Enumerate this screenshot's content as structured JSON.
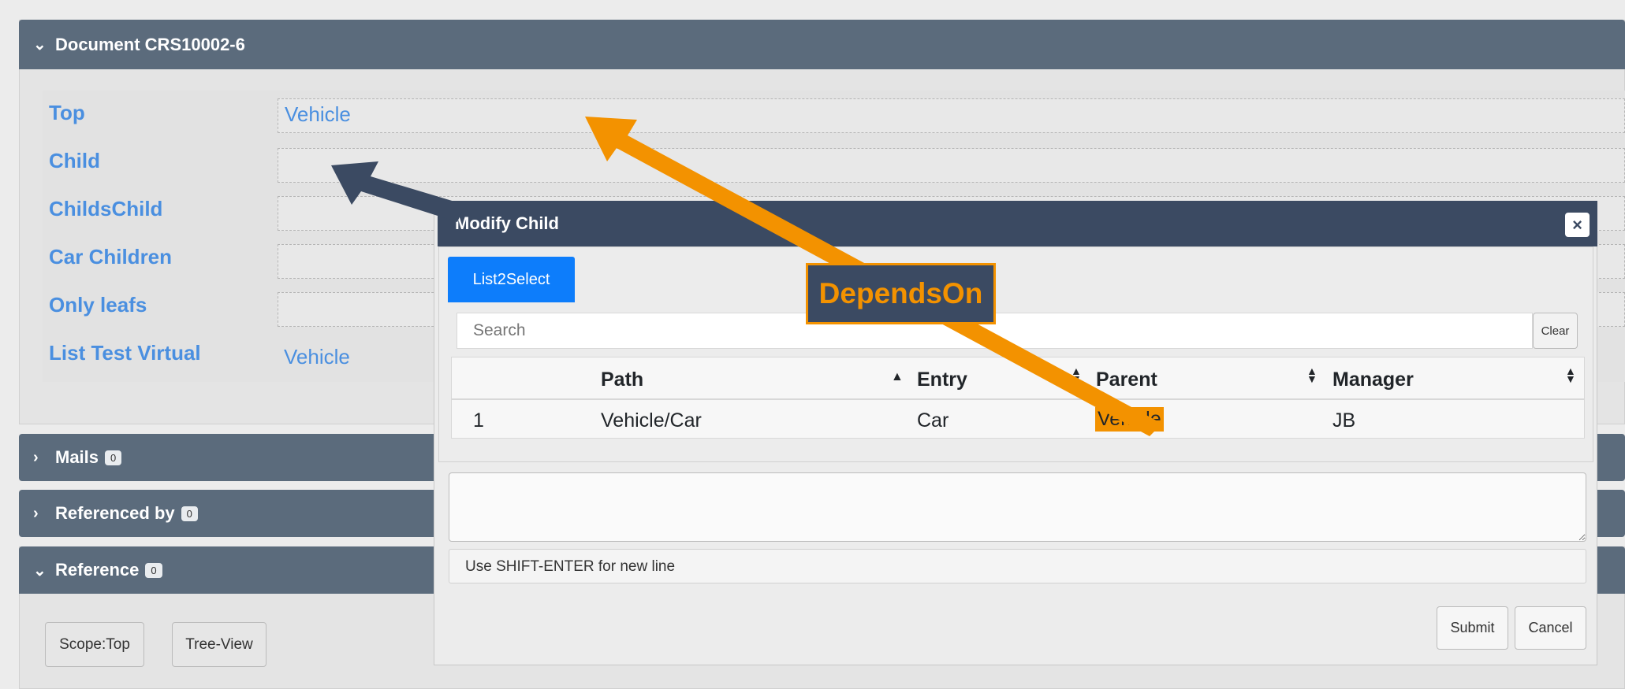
{
  "document_panel": {
    "title": "Document CRS10002-6",
    "fields": [
      {
        "label": "Top",
        "value": "Vehicle"
      },
      {
        "label": "Child",
        "value": ""
      },
      {
        "label": "ChildsChild",
        "value": ""
      },
      {
        "label": "Car Children",
        "value": ""
      },
      {
        "label": "Only leafs",
        "value": ""
      },
      {
        "label": "List Test Virtual",
        "value": "Vehicle"
      }
    ]
  },
  "mails_panel": {
    "title": "Mails",
    "count": "0"
  },
  "referenced_by_panel": {
    "title": "Referenced by",
    "count": "0"
  },
  "reference_panel": {
    "title": "Reference",
    "count": "0",
    "scope_button": "Scope:Top",
    "tree_button": "Tree-View"
  },
  "modal": {
    "title": "Modify Child",
    "close_icon": "×",
    "tab": "List2Select",
    "search_placeholder": "Search",
    "clear_label": "Clear",
    "columns": [
      "Path",
      "Entry",
      "Parent",
      "Manager"
    ],
    "rows": [
      {
        "num": "1",
        "path": "Vehicle/Car",
        "entry": "Car",
        "parent": "Vehicle",
        "manager": "JB"
      }
    ],
    "hint": "Use SHIFT-ENTER for new line",
    "submit_label": "Submit",
    "cancel_label": "Cancel"
  },
  "annotation": {
    "callout": "DependsOn",
    "colors": {
      "orange": "#f39200",
      "navy": "#3b4a62"
    }
  }
}
